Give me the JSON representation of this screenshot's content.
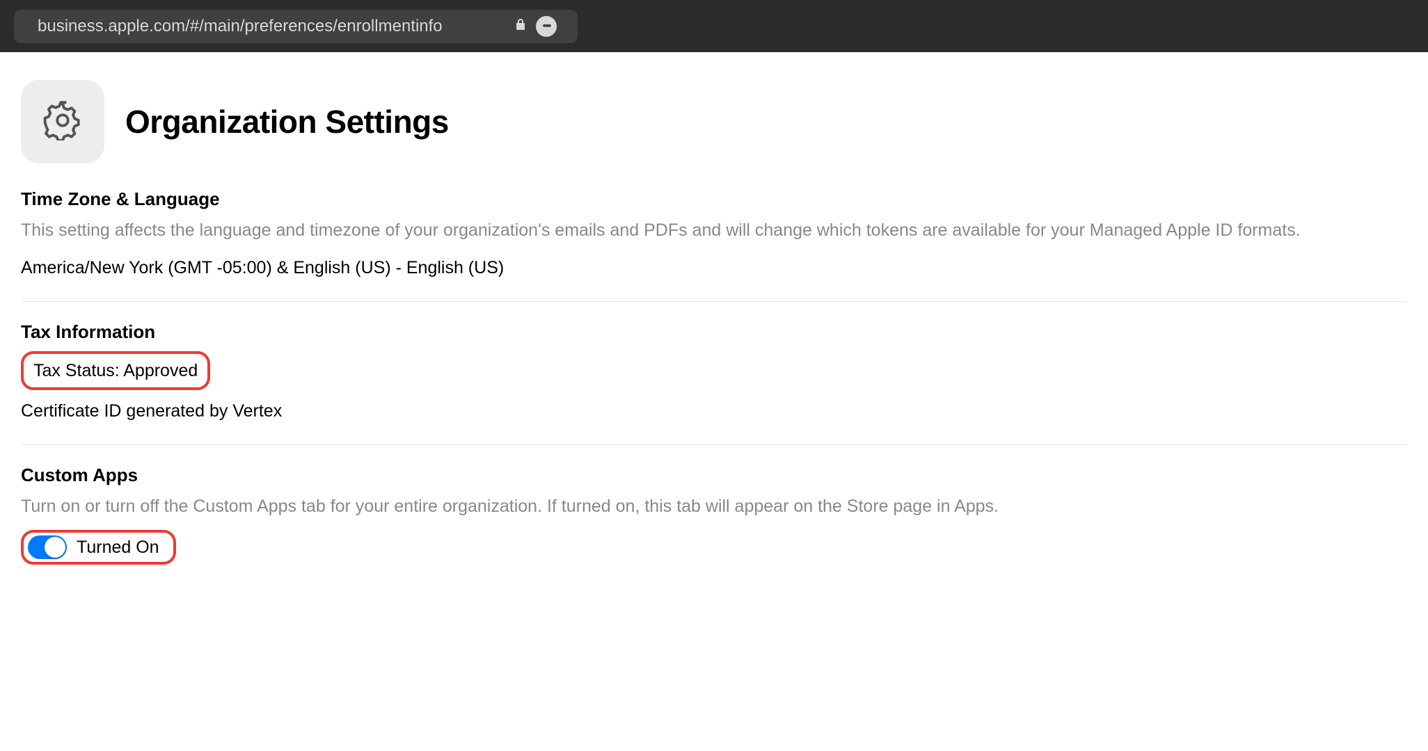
{
  "address_bar": {
    "url": "business.apple.com/#/main/preferences/enrollmentinfo"
  },
  "page": {
    "title": "Organization Settings"
  },
  "sections": {
    "timezone": {
      "heading": "Time Zone & Language",
      "description": "This setting affects the language and timezone of your organization's emails and PDFs and will change which tokens are available for your Managed Apple ID formats.",
      "value": "America/New York (GMT -05:00) & English (US) - English (US)"
    },
    "tax": {
      "heading": "Tax Information",
      "status": "Tax Status: Approved",
      "certificate": "Certificate ID generated by Vertex"
    },
    "custom_apps": {
      "heading": "Custom Apps",
      "description": "Turn on or turn off the Custom Apps tab for your entire organization. If turned on, this tab will appear on the Store page in Apps.",
      "toggle_label": "Turned On"
    }
  }
}
